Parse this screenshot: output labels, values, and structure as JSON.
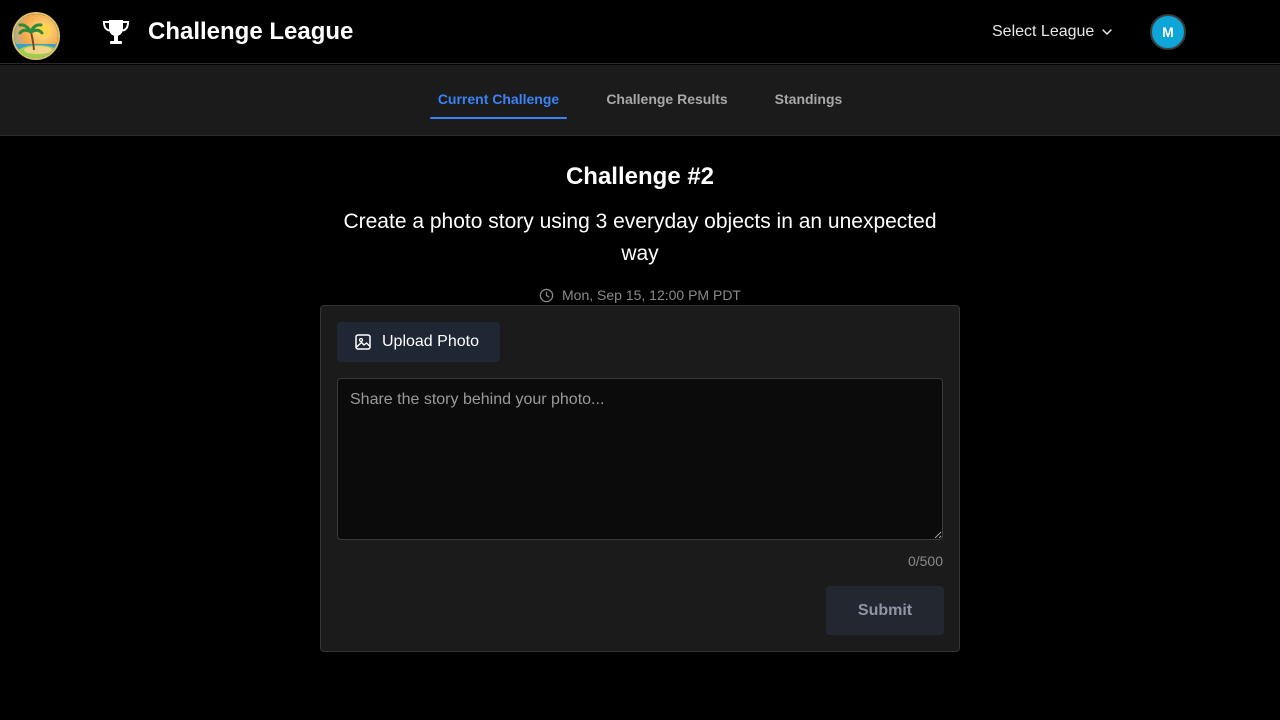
{
  "header": {
    "app_title": "Challenge League",
    "league_select_label": "Select League",
    "avatar_initial": "M",
    "logo_icon": "palm-island-logo",
    "trophy_icon": "trophy-icon"
  },
  "tabs": [
    {
      "label": "Current Challenge",
      "active": true
    },
    {
      "label": "Challenge Results",
      "active": false
    },
    {
      "label": "Standings",
      "active": false
    }
  ],
  "challenge": {
    "title": "Challenge #2",
    "prompt": "Create a photo story using 3 everyday objects in an unexpected way",
    "deadline": "Mon, Sep 15, 12:00 PM PDT"
  },
  "submission": {
    "upload_label": "Upload Photo",
    "story_placeholder": "Share the story behind your photo...",
    "story_value": "",
    "char_count": "0/500",
    "submit_label": "Submit"
  },
  "colors": {
    "accent": "#3b82f6",
    "avatar_bg": "#0ea5d9",
    "background": "#000000",
    "panel": "#1b1b1b"
  }
}
